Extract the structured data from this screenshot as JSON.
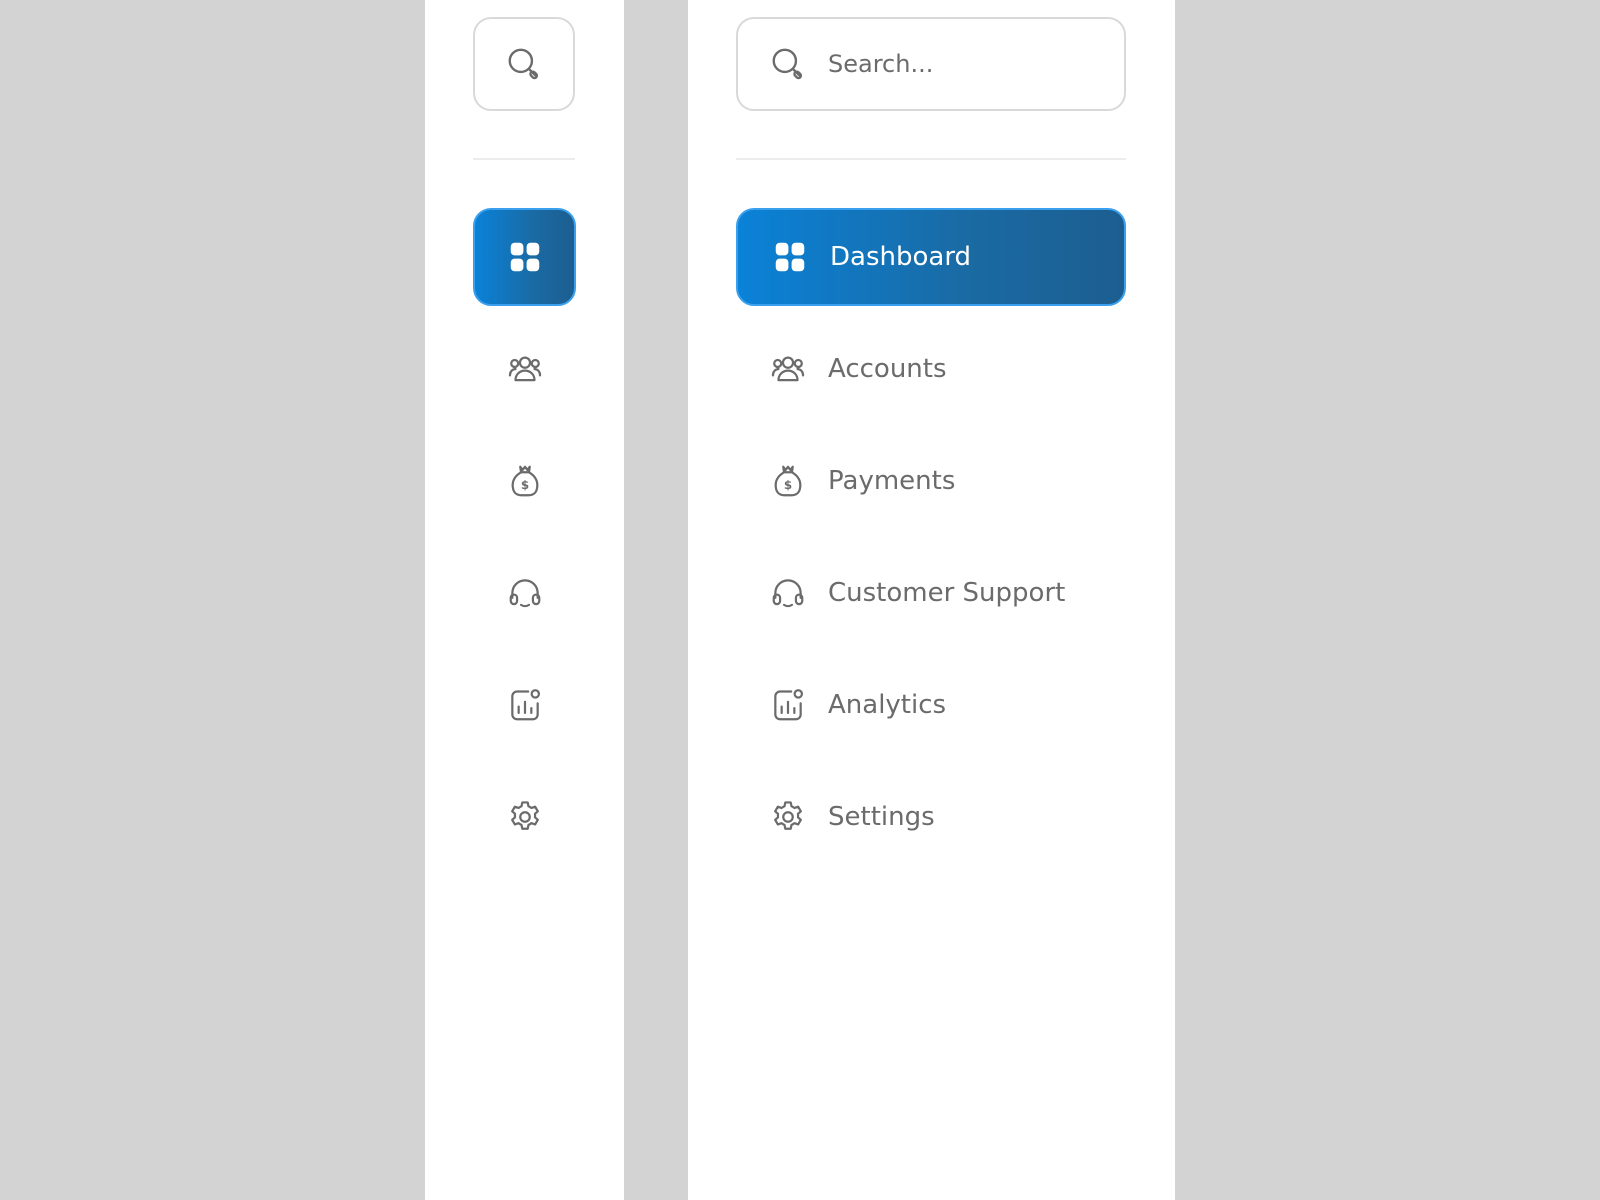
{
  "search": {
    "placeholder": "Search..."
  },
  "nav": {
    "items": [
      {
        "label": "Dashboard",
        "icon": "dashboard-grid-icon",
        "active": true
      },
      {
        "label": "Accounts",
        "icon": "users-group-icon",
        "active": false
      },
      {
        "label": "Payments",
        "icon": "money-bag-icon",
        "active": false
      },
      {
        "label": "Customer Support",
        "icon": "headset-icon",
        "active": false
      },
      {
        "label": "Analytics",
        "icon": "analytics-chart-icon",
        "active": false
      },
      {
        "label": "Settings",
        "icon": "gear-icon",
        "active": false
      }
    ]
  },
  "colors": {
    "page_background": "#d3d3d3",
    "panel_background": "#ffffff",
    "active_gradient_start": "#0a82d8",
    "active_gradient_end": "#1c5e90",
    "icon_text_color": "#6b6b6b"
  }
}
